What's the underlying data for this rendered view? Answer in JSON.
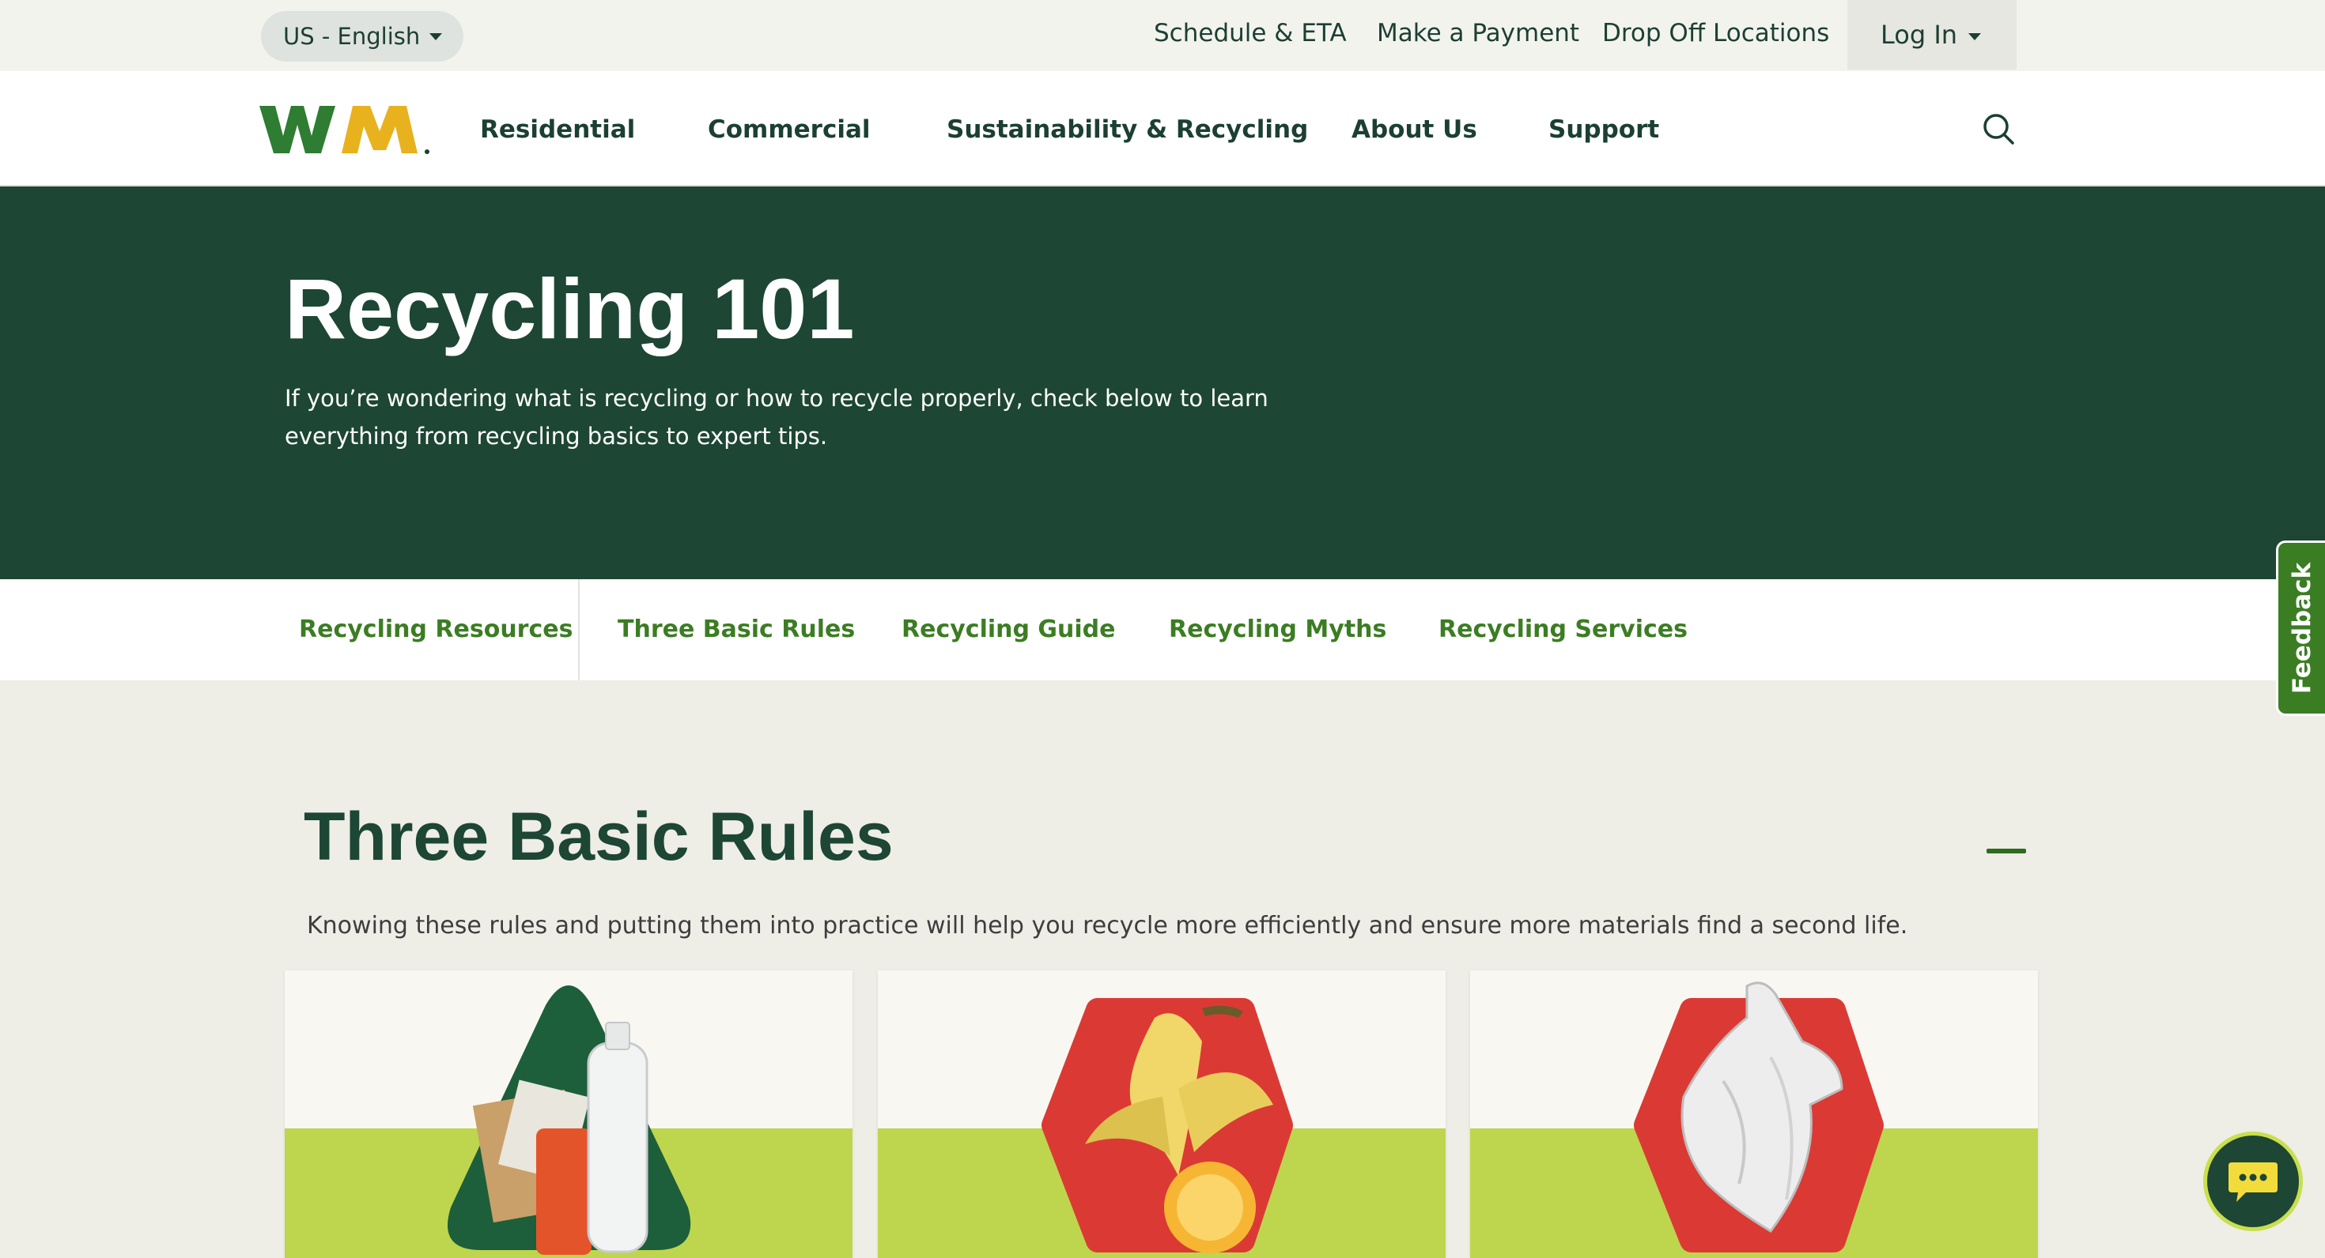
{
  "utility": {
    "language": "US - English",
    "links": [
      "Schedule & ETA",
      "Make a Payment",
      "Drop Off Locations"
    ],
    "login": "Log In"
  },
  "nav": {
    "logo_text": "WM",
    "items": [
      "Residential",
      "Commercial",
      "Sustainability & Recycling",
      "About Us",
      "Support"
    ],
    "search_icon": "search-icon"
  },
  "hero": {
    "title": "Recycling 101",
    "description": "If you’re wondering what is recycling or how to recycle properly, check below to learn everything from recycling basics to expert tips."
  },
  "subnav": {
    "items": [
      "Recycling Resources",
      "Three Basic Rules",
      "Recycling Guide",
      "Recycling Myths",
      "Recycling Services"
    ]
  },
  "section": {
    "title": "Three Basic Rules",
    "description": "Knowing these rules and putting them into practice will help you recycle more efficiently and ensure more materials find a second life.",
    "cards": [
      {
        "icon": "recyclables-triangle-icon"
      },
      {
        "icon": "food-waste-hexagon-icon"
      },
      {
        "icon": "plastic-bag-hexagon-icon"
      }
    ]
  },
  "feedback": {
    "label": "Feedback"
  },
  "chat": {
    "icon": "chat-icon"
  },
  "colors": {
    "primary_green": "#1d4634",
    "accent_green": "#3b7d23",
    "lime": "#bed64e",
    "stop_red": "#db3a34",
    "logo_yellow": "#e8b21f"
  }
}
